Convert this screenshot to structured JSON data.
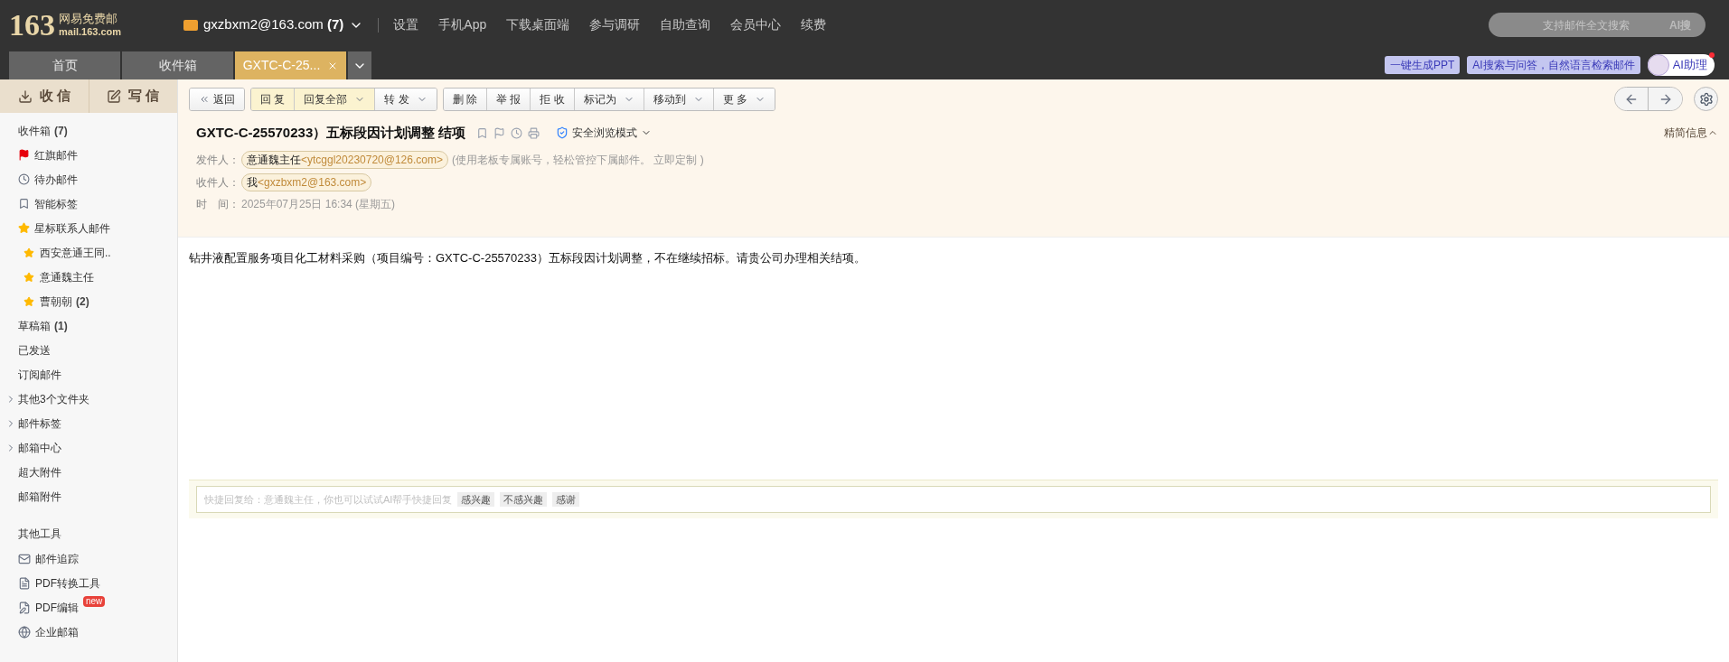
{
  "logo": {
    "number": "163",
    "name": "网易免费邮",
    "domain": "mail.163.com"
  },
  "account": {
    "address": "gxzbxm2@163.com",
    "count": "(7)"
  },
  "top_links": [
    "设置",
    "手机App",
    "下载桌面端",
    "参与调研",
    "自助查询",
    "会员中心",
    "续费"
  ],
  "search": {
    "placeholder": "支持邮件全文搜索",
    "ai_label": "AI搜"
  },
  "tabs": [
    {
      "label": "首页",
      "selected": false,
      "closable": false
    },
    {
      "label": "收件箱",
      "selected": false,
      "closable": false
    },
    {
      "label": "GXTC-C-25...",
      "selected": true,
      "closable": true
    }
  ],
  "ai_buttons": [
    "一键生成PPT",
    "AI搜索与问答，自然语言检索邮件"
  ],
  "ai_assistant": "AI助理",
  "sidebar": {
    "receive": "收 信",
    "compose": "写 信",
    "items": [
      {
        "label": "收件箱",
        "count": "(7)",
        "expandable": false
      },
      {
        "label": "红旗邮件",
        "expandable": false
      },
      {
        "label": "待办邮件",
        "expandable": false
      },
      {
        "label": "智能标签",
        "expandable": false
      },
      {
        "label": "星标联系人邮件",
        "expandable": false,
        "children": [
          {
            "label": "西安意通王同.."
          },
          {
            "label": "意通魏主任"
          },
          {
            "label": "曹朝朝",
            "count": "(2)"
          }
        ]
      },
      {
        "label": "草稿箱",
        "count": "(1)",
        "expandable": false
      },
      {
        "label": "已发送",
        "expandable": false
      },
      {
        "label": "订阅邮件",
        "expandable": false
      },
      {
        "label": "其他3个文件夹",
        "expandable": true
      },
      {
        "label": "邮件标签",
        "expandable": true
      },
      {
        "label": "邮箱中心",
        "expandable": true
      },
      {
        "label": "超大附件",
        "expandable": false
      },
      {
        "label": "邮箱附件",
        "expandable": false
      }
    ],
    "tools_title": "其他工具",
    "tools": [
      {
        "label": "邮件追踪"
      },
      {
        "label": "PDF转换工具"
      },
      {
        "label": "PDF编辑",
        "badge": "new"
      },
      {
        "label": "企业邮箱"
      }
    ]
  },
  "toolbar": [
    {
      "buttons": [
        {
          "label": "返回",
          "dropdown": false,
          "highlight": false
        }
      ]
    },
    {
      "buttons": [
        {
          "label": "回 复",
          "dropdown": false,
          "highlight": true
        },
        {
          "label": "回复全部",
          "dropdown": true,
          "highlight": true
        },
        {
          "label": "转 发",
          "dropdown": true,
          "highlight": false
        }
      ]
    },
    {
      "buttons": [
        {
          "label": "删 除",
          "dropdown": false,
          "highlight": false
        },
        {
          "label": "举 报",
          "dropdown": false,
          "highlight": false
        },
        {
          "label": "拒 收",
          "dropdown": false,
          "highlight": false
        },
        {
          "label": "标记为",
          "dropdown": true,
          "highlight": false
        },
        {
          "label": "移动到",
          "dropdown": true,
          "highlight": false
        },
        {
          "label": "更 多",
          "dropdown": true,
          "highlight": false
        }
      ]
    }
  ],
  "mail": {
    "subject": "GXTC-C-25570233）五标段因计划调整 结项",
    "safe_mode": "安全浏览模式",
    "summary_toggle": "精简信息",
    "from_label": "发件人：",
    "from": "意通魏主任",
    "from_address": "<ytcggl20230720@126.com>",
    "from_note": "(使用老板专属账号，轻松管控下属邮件。 立即定制 )",
    "to_label": "收件人：",
    "to": "我",
    "to_address": "<gxzbxm2@163.com>",
    "time_label": "时　间：",
    "time": "2025年07月25日 16:34 (星期五)",
    "body": "钻井液配置服务项目化工材料采购（项目编号：GXTC-C-25570233）五标段因计划调整，不在继续招标。请贵公司办理相关结项。"
  },
  "quick_reply": {
    "placeholder": "快捷回复给：意通魏主任，你也可以试试AI帮手快捷回复",
    "chips": [
      "感兴趣",
      "不感兴趣",
      "感谢"
    ]
  }
}
